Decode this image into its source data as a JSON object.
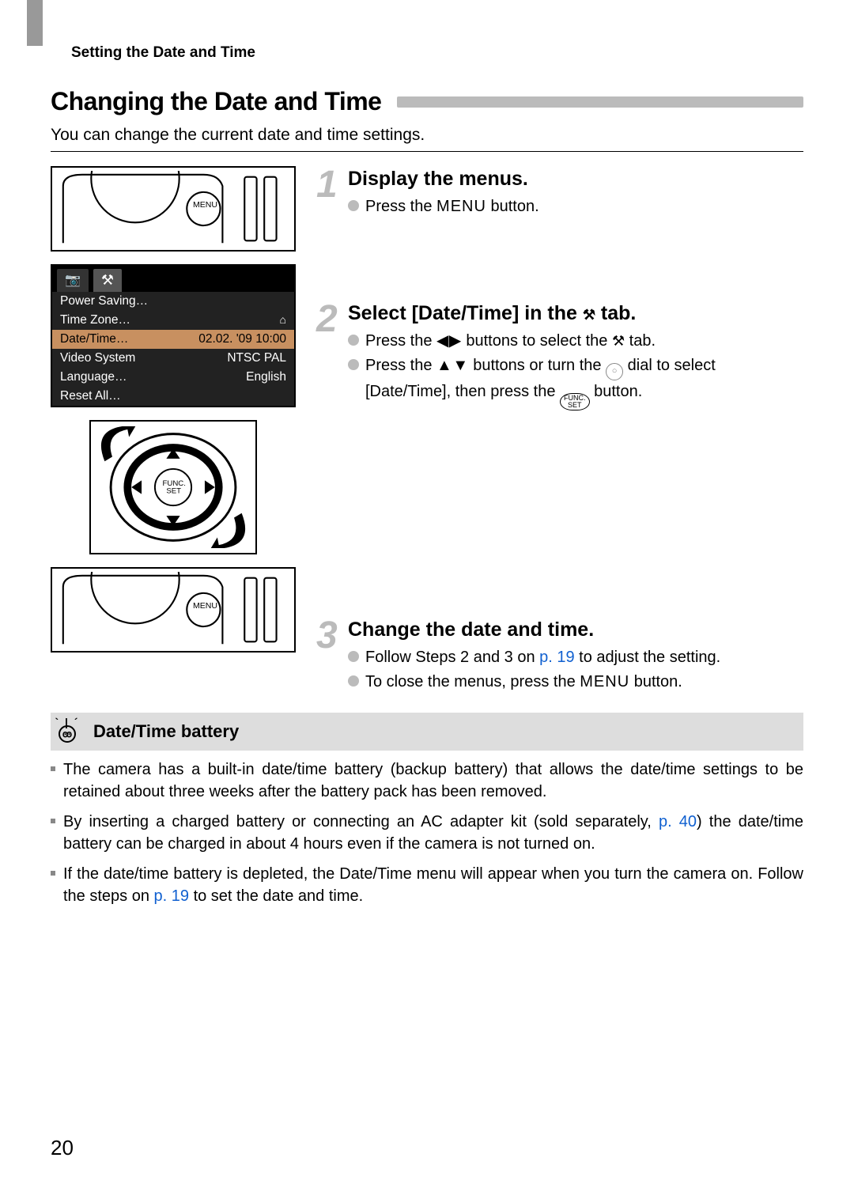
{
  "running_header": "Setting the Date and Time",
  "section_title": "Changing the Date and Time",
  "intro": "You can change the current date and time settings.",
  "screen": {
    "tab_camera_icon": "📷",
    "tab_tools_icon": "⚒",
    "rows": [
      {
        "label": "Power Saving…",
        "value": ""
      },
      {
        "label": "Time Zone…",
        "value": "⌂"
      },
      {
        "label": "Date/Time…",
        "value": "02.02. '09 10:00",
        "selected": true
      },
      {
        "label": "Video System",
        "value": "NTSC   PAL"
      },
      {
        "label": "Language…",
        "value": "English"
      },
      {
        "label": "Reset All…",
        "value": ""
      }
    ]
  },
  "steps": {
    "s1": {
      "num": "1",
      "title": "Display the menus.",
      "press_prefix": "Press the ",
      "menu_glyph": "MENU",
      "press_suffix": " button."
    },
    "s2": {
      "num": "2",
      "title_prefix": "Select [Date/Time] in the ",
      "title_icon": "⚒",
      "title_suffix": " tab.",
      "b1_prefix": "Press the ",
      "b1_lr": "◀▶",
      "b1_mid": " buttons to select the ",
      "b1_icon": "⚒",
      "b1_suffix": " tab.",
      "b2_prefix": "Press the ",
      "b2_ud": "▲▼",
      "b2_mid": " buttons or turn the ",
      "b2_mid2": " dial to select [Date/Time], then press the ",
      "b2_func_top": "FUNC.",
      "b2_func_bot": "SET",
      "b2_suffix": " button."
    },
    "s3": {
      "num": "3",
      "title": "Change the date and time.",
      "b1_prefix": "Follow Steps 2 and 3 on ",
      "b1_link": "p. 19",
      "b1_suffix": " to adjust the setting.",
      "b2_prefix": "To close the menus, press the ",
      "b2_menu": "MENU",
      "b2_suffix": " button."
    }
  },
  "tip": {
    "header": "Date/Time battery",
    "items": {
      "i1": "The camera has a built-in date/time battery (backup battery) that allows the date/time settings to be retained about three weeks after the battery pack has been removed.",
      "i2_prefix": "By inserting a charged battery or connecting an AC adapter kit (sold separately, ",
      "i2_link": "p. 40",
      "i2_suffix": ") the date/time battery can be charged in about 4 hours even if the camera is not turned on.",
      "i3_prefix": "If the date/time battery is depleted, the Date/Time menu will appear when you turn the camera on. Follow the steps on ",
      "i3_link": "p. 19",
      "i3_suffix": " to set the date and time."
    }
  },
  "page_number": "20"
}
